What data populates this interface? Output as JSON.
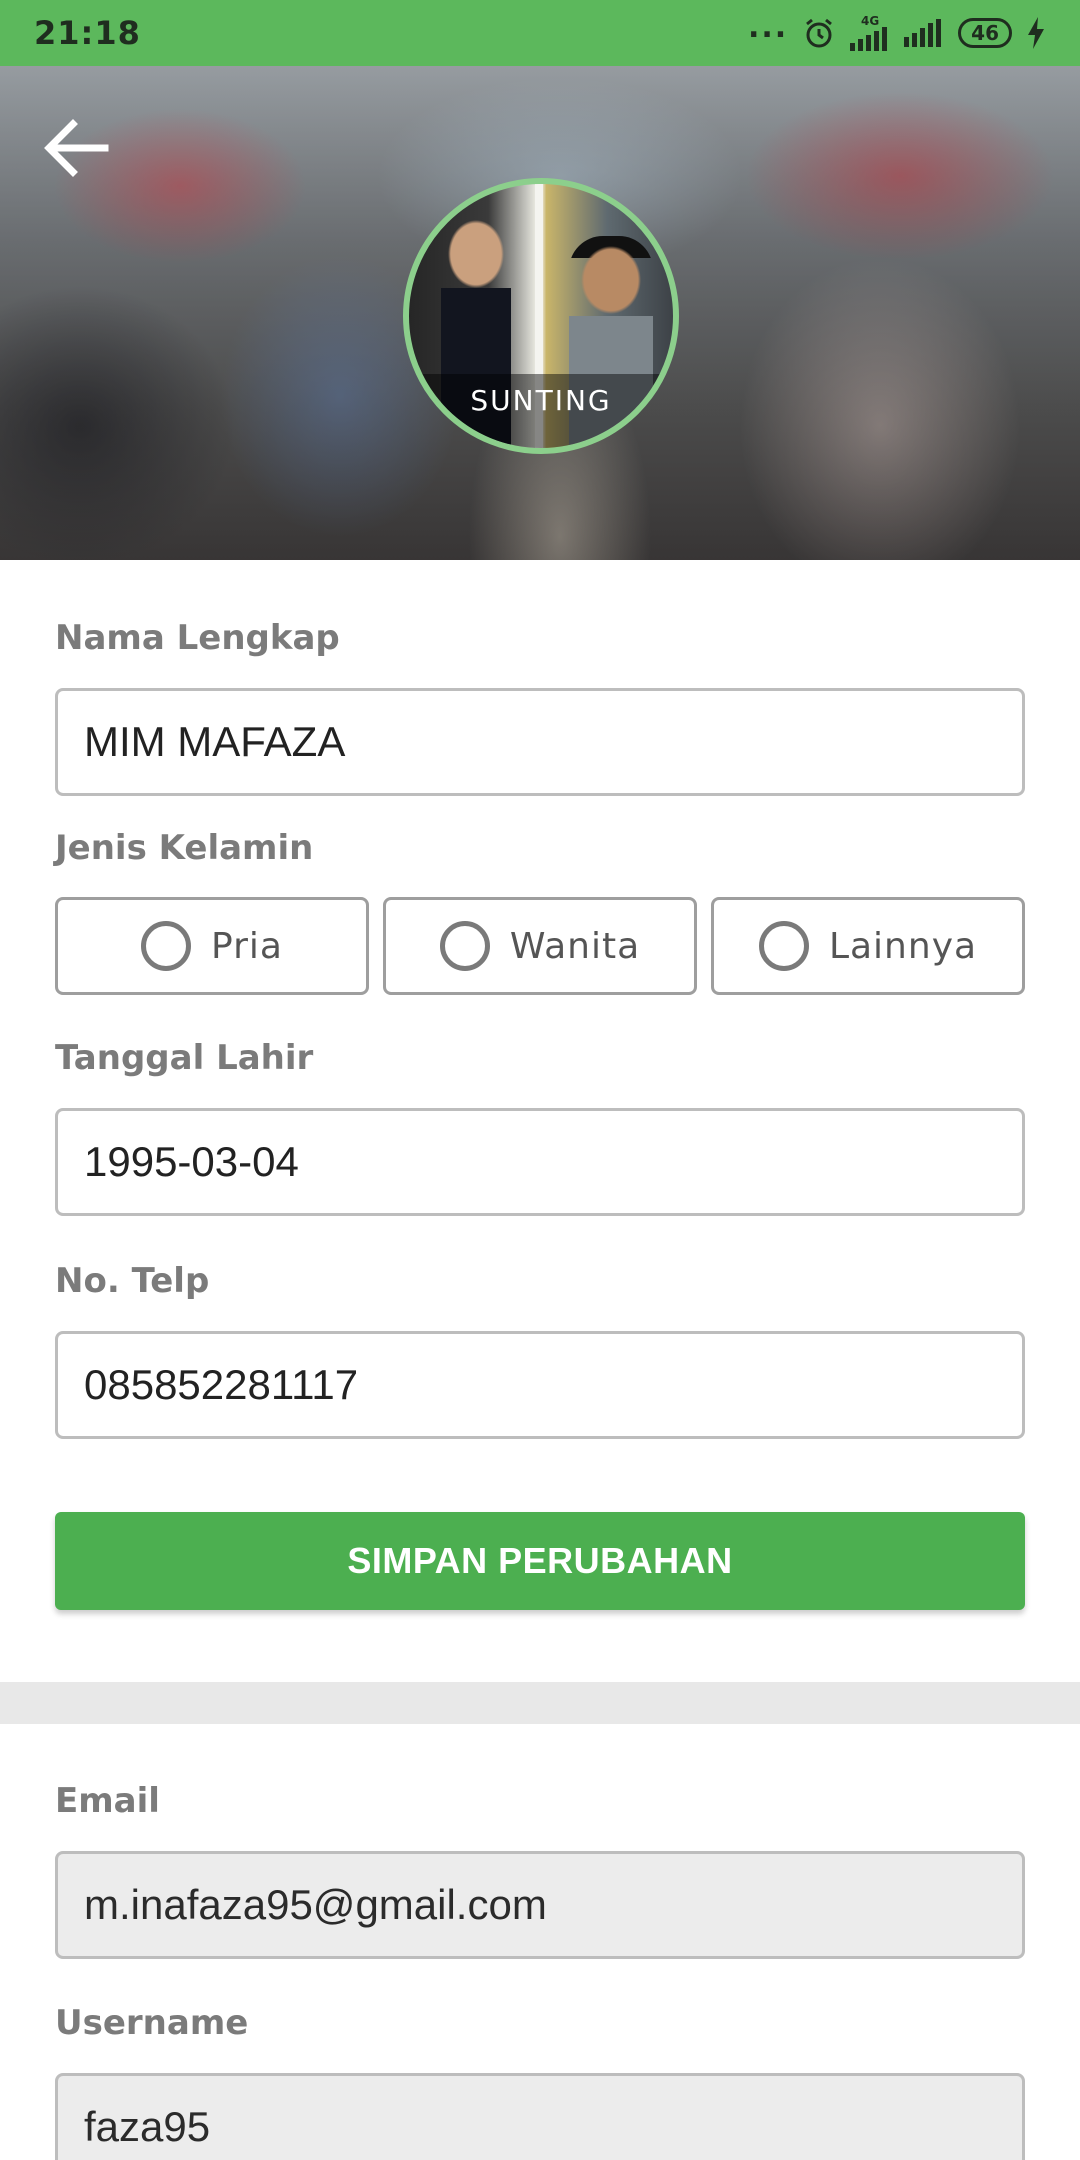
{
  "status_bar": {
    "time": "21:18",
    "dots": "...",
    "network_label": "4G",
    "battery": "46",
    "icons": [
      "alarm-icon",
      "signal-icon",
      "signal-icon",
      "battery-icon",
      "charging-icon"
    ]
  },
  "header": {
    "back_icon": "arrow-left-icon",
    "avatar_edit_label": "SUNTING"
  },
  "form": {
    "full_name": {
      "label": "Nama Lengkap",
      "value": "MIM MAFAZA"
    },
    "gender": {
      "label": "Jenis Kelamin",
      "options": [
        "Pria",
        "Wanita",
        "Lainnya"
      ]
    },
    "birth_date": {
      "label": "Tanggal Lahir",
      "value": "1995-03-04"
    },
    "phone": {
      "label": "No. Telp",
      "value": "085852281117"
    },
    "save_label": "SIMPAN PERUBAHAN"
  },
  "account": {
    "email": {
      "label": "Email",
      "value": "m.inafaza95@gmail.com"
    },
    "username": {
      "label": "Username",
      "value": "faza95"
    }
  },
  "colors": {
    "primary": "#4caf50",
    "status_bar": "#5cb85c",
    "label": "#7b7b7b",
    "border": "#bdbdbd"
  }
}
